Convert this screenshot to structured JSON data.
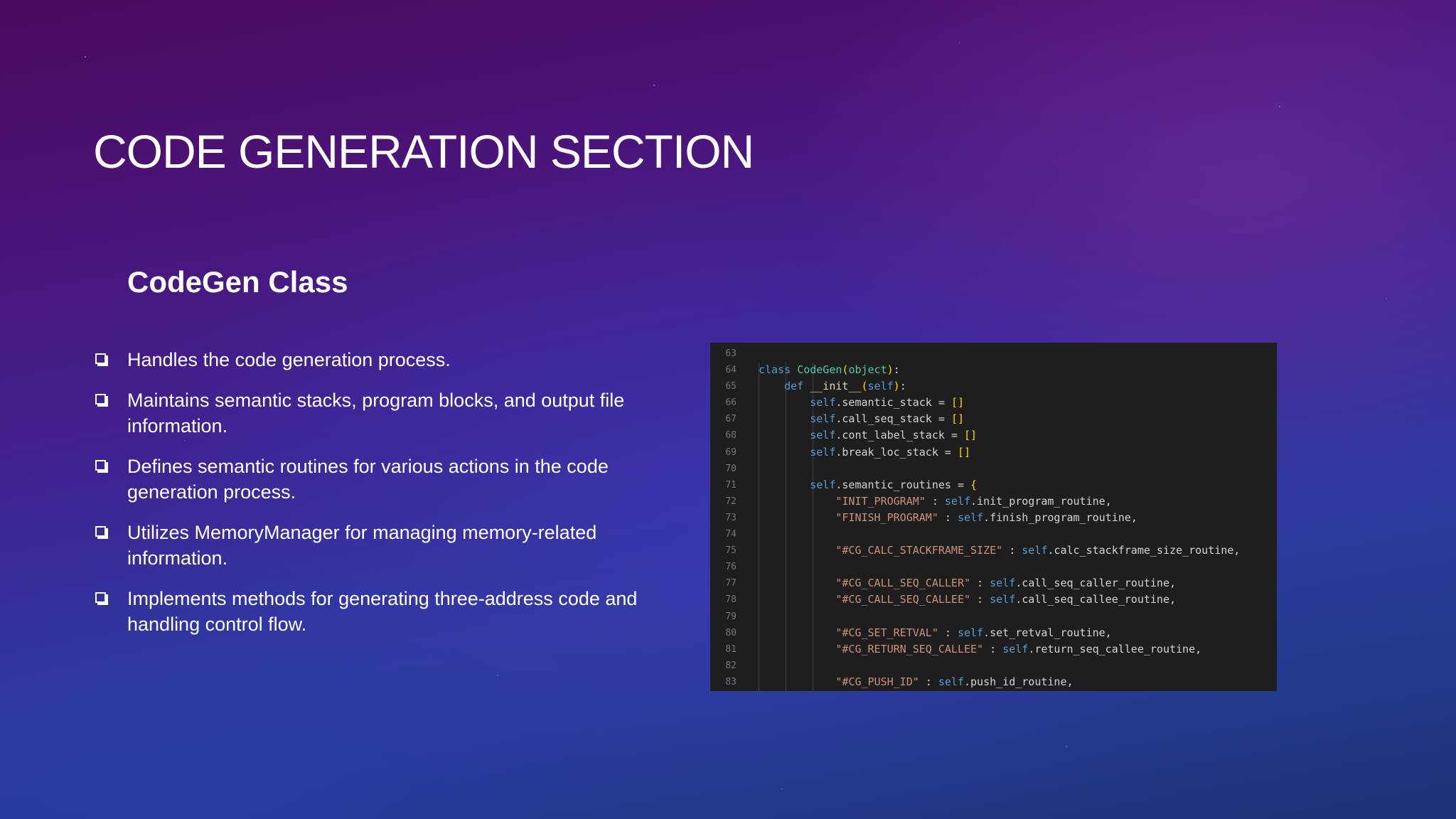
{
  "slide": {
    "title": "CODE GENERATION SECTION",
    "subtitle": "CodeGen Class",
    "bullets": [
      "Handles the code generation process.",
      "Maintains semantic stacks, program blocks, and output file information.",
      "Defines semantic routines for various actions in the code generation process.",
      "Utilizes MemoryManager for managing memory-related information.",
      "Implements methods for generating three-address code and handling control flow."
    ]
  },
  "code": {
    "lines": [
      {
        "n": "63",
        "text": ""
      },
      {
        "n": "64",
        "text": "class CodeGen(object):"
      },
      {
        "n": "65",
        "text": "    def __init__(self):"
      },
      {
        "n": "66",
        "text": "        self.semantic_stack = []"
      },
      {
        "n": "67",
        "text": "        self.call_seq_stack = []"
      },
      {
        "n": "68",
        "text": "        self.cont_label_stack = []"
      },
      {
        "n": "69",
        "text": "        self.break_loc_stack = []"
      },
      {
        "n": "70",
        "text": ""
      },
      {
        "n": "71",
        "text": "        self.semantic_routines = {"
      },
      {
        "n": "72",
        "text": "            \"INIT_PROGRAM\" : self.init_program_routine,"
      },
      {
        "n": "73",
        "text": "            \"FINISH_PROGRAM\" : self.finish_program_routine,"
      },
      {
        "n": "74",
        "text": ""
      },
      {
        "n": "75",
        "text": "            \"#CG_CALC_STACKFRAME_SIZE\" : self.calc_stackframe_size_routine,"
      },
      {
        "n": "76",
        "text": ""
      },
      {
        "n": "77",
        "text": "            \"#CG_CALL_SEQ_CALLER\" : self.call_seq_caller_routine,"
      },
      {
        "n": "78",
        "text": "            \"#CG_CALL_SEQ_CALLEE\" : self.call_seq_callee_routine,"
      },
      {
        "n": "79",
        "text": ""
      },
      {
        "n": "80",
        "text": "            \"#CG_SET_RETVAL\" : self.set_retval_routine,"
      },
      {
        "n": "81",
        "text": "            \"#CG_RETURN_SEQ_CALLEE\" : self.return_seq_callee_routine,"
      },
      {
        "n": "82",
        "text": ""
      },
      {
        "n": "83",
        "text": "            \"#CG_PUSH_ID\" : self.push_id_routine,"
      }
    ]
  },
  "colors": {
    "code_bg": "#1e1e1e",
    "keyword": "#569cd6",
    "class_name": "#4ec9b0",
    "function": "#dcdcaa",
    "string": "#ce9178",
    "bracket": "#ffd700",
    "variable": "#9cdcfe"
  }
}
